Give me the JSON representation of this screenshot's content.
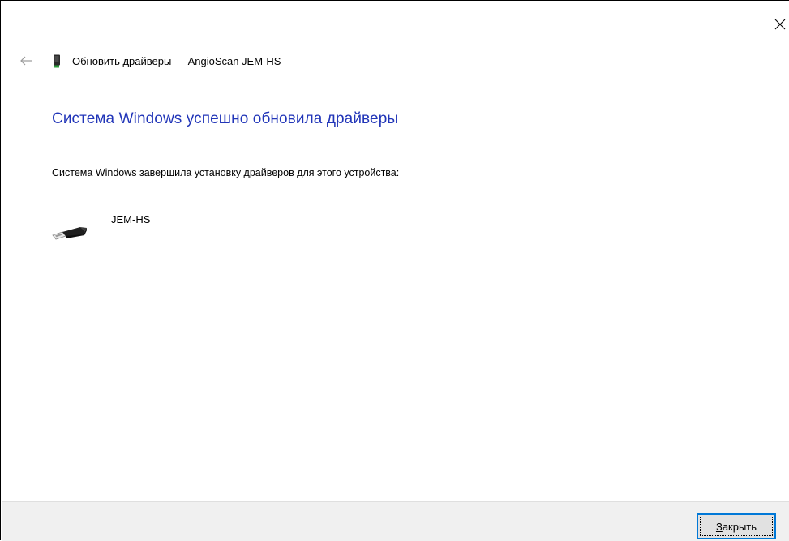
{
  "window": {
    "title": "Обновить драйверы — AngioScan JEM-HS",
    "close_icon": "close-icon",
    "back_icon": "back-arrow-icon"
  },
  "content": {
    "heading": "Система Windows успешно обновила драйверы",
    "description": "Система Windows завершила установку драйверов для этого устройства:",
    "device": {
      "name": "JEM-HS",
      "icon": "usb-connector-icon"
    }
  },
  "footer": {
    "close_button": {
      "mnemonic": "З",
      "rest": "акрыть"
    }
  },
  "colors": {
    "heading": "#2135b8",
    "footer_bg": "#f0f0f0",
    "focus_border": "#0078d7"
  }
}
